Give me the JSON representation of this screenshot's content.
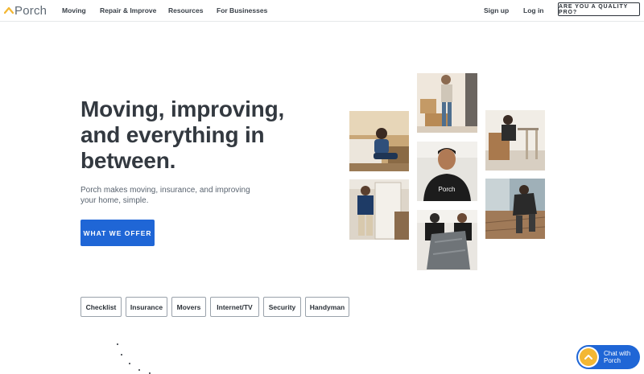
{
  "header": {
    "logo_text": "Porch",
    "nav": {
      "moving": "Moving",
      "repair": "Repair & Improve",
      "resources": "Resources",
      "business": "For Businesses"
    },
    "sign_up": "Sign up",
    "log_in": "Log in",
    "pro_button": "ARE YOU A QUALITY PRO?"
  },
  "hero": {
    "title": "Moving, improving, and everything in between.",
    "subtitle": "Porch makes moving, insurance, and improving your home, simple.",
    "cta": "WHAT WE OFFER"
  },
  "categories": [
    "Checklist",
    "Insurance",
    "Movers",
    "Internet/TV",
    "Security",
    "Handyman"
  ],
  "photo_shirt_text": "Porch",
  "chat": {
    "label_line1": "Chat with",
    "label_line2": "Porch"
  },
  "colors": {
    "accent": "#1f66d6",
    "brand_yellow": "#f3b733",
    "text_dark": "#333940"
  }
}
